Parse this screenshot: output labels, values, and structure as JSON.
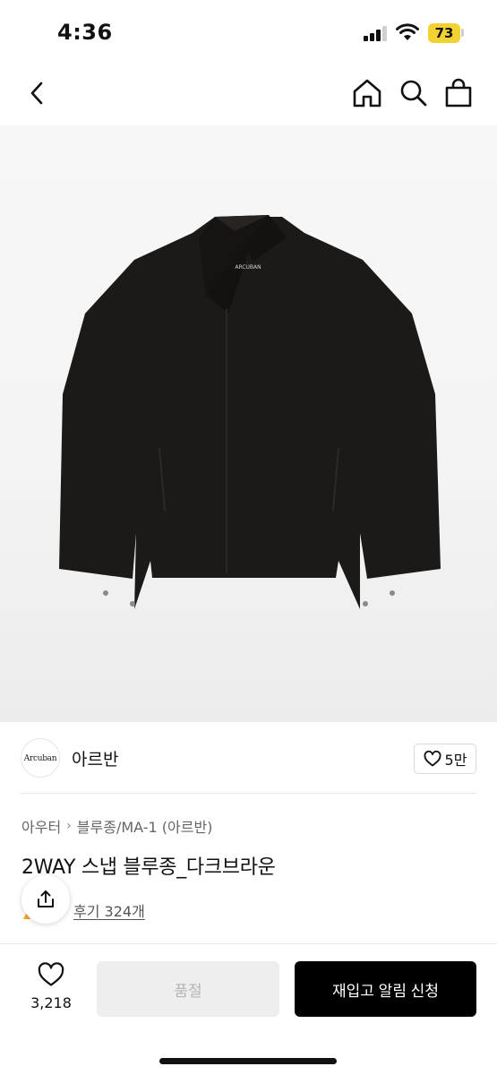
{
  "status_bar": {
    "time": "4:36",
    "battery": "73"
  },
  "nav": {
    "back_icon": "chevron-left-icon",
    "home_icon": "home-icon",
    "search_icon": "search-icon",
    "bag_icon": "shopping-bag-icon"
  },
  "brand": {
    "logo_text": "Arcuban",
    "name": "아르반",
    "likes": "5만"
  },
  "breadcrumb": {
    "category": "아우터",
    "subcategory": "블루종/MA-1 (아르반)"
  },
  "product": {
    "title": "2WAY 스냅 블루종_다크브라운",
    "review_link": "후기 324개",
    "image_label": "ARCUBAN"
  },
  "bottom_bar": {
    "wish_count": "3,218",
    "soldout_label": "품절",
    "restock_label": "재입고 알림 신청"
  },
  "colors": {
    "accent_battery": "#f2d230",
    "primary_button": "#000000",
    "disabled_button": "#eeeeee"
  }
}
